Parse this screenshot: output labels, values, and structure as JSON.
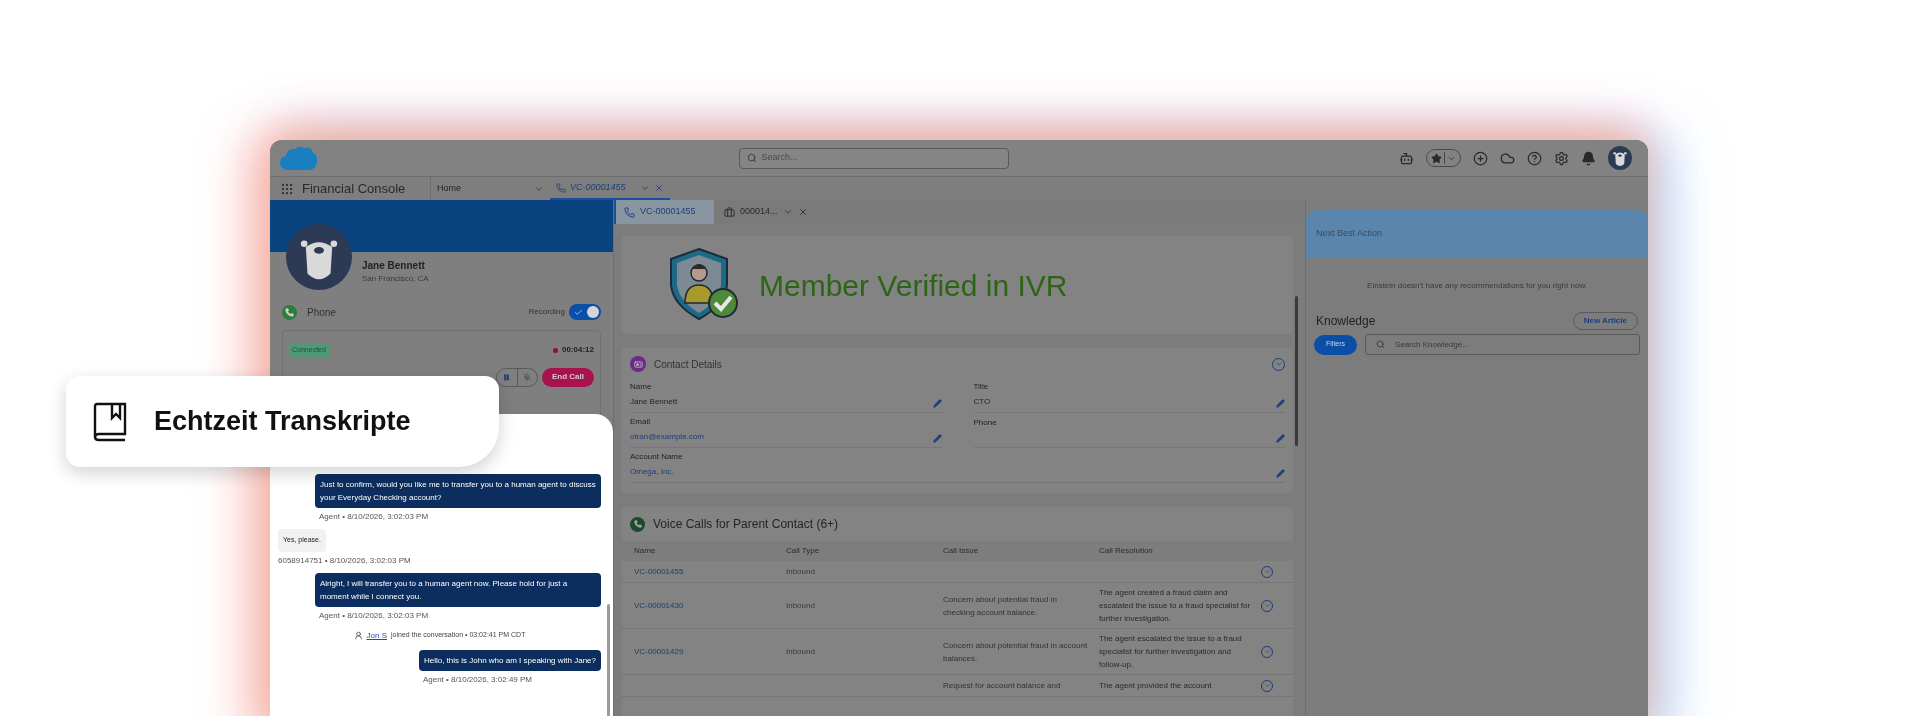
{
  "header": {
    "search_placeholder": "Search..."
  },
  "nav": {
    "app_name": "Financial Console",
    "home_tab": "Home",
    "tabs": [
      {
        "label": "VC-00001455",
        "selected": true
      }
    ]
  },
  "contact_card": {
    "name": "Jane Bennett",
    "location": "San Francisco, CA"
  },
  "phone": {
    "label": "Phone",
    "recording_label": "Recording",
    "recording_on": true,
    "status": "Connected",
    "timer": "00:04:12",
    "end_call": "End Call"
  },
  "subtabs": [
    {
      "label": "VC-00001455",
      "selected": true,
      "kind": "call"
    },
    {
      "label": "000014...",
      "selected": false,
      "kind": "case"
    }
  ],
  "banner": {
    "text": "Member Verified in IVR"
  },
  "contact_details": {
    "title": "Contact Details",
    "fields": [
      {
        "label": "Name",
        "value": "Jane Bennett",
        "link": false,
        "full_width": false
      },
      {
        "label": "Title",
        "value": "CTO",
        "link": false,
        "full_width": false
      },
      {
        "label": "Email",
        "value": "otran@example.com",
        "link": true,
        "full_width": false
      },
      {
        "label": "Phone",
        "full_width": false
      },
      {
        "label": "Account Name",
        "value": "Omega, Inc.",
        "link": true,
        "full_width": true
      }
    ]
  },
  "voice_calls": {
    "title": "Voice Calls for Parent Contact (6+)",
    "columns": [
      "Name",
      "Call Type",
      "Call Issue",
      "Call Resolution"
    ],
    "rows": [
      {
        "name": "VC-00001455",
        "call_type": "Inbound"
      },
      {
        "name": "VC-00001430",
        "call_type": "Inbound",
        "issue": "Concern about potential fraud in checking account balance.",
        "resolution": "The agent created a fraud claim and escalated the issue to a fraud specialist for further investigation."
      },
      {
        "name": "VC-00001429",
        "call_type": "Inbound",
        "issue": "Concern about potential fraud in account balances.",
        "resolution": "The agent escalated the issue to a fraud specialist for further investigation and follow-up."
      },
      {
        "issue": "Request for account balance and",
        "resolution": "The agent provided the account"
      }
    ]
  },
  "next_best_action": {
    "title": "Next Best Action",
    "message": "Einstein doesn't have any recommendations for you right now."
  },
  "knowledge": {
    "title": "Knowledge",
    "new_button": "New Article",
    "filters_button": "Filters",
    "search_placeholder": "Search Knowledge..."
  },
  "callout": {
    "label": "Echtzeit Transkripte"
  },
  "transcript": {
    "messages": [
      {
        "kind": "agent",
        "text": "Just to confirm, would you like me to transfer you to a human agent to discuss your Everyday Checking account?",
        "meta": "Agent • 8/10/2026, 3:02:03 PM"
      },
      {
        "kind": "customer",
        "text": "Yes, please.",
        "meta": "6058914751 • 8/10/2026, 3:02:03 PM"
      },
      {
        "kind": "agent",
        "text": "Alright, I will transfer you to a human agent now. Please hold for just a moment while I connect you.",
        "meta": "Agent • 8/10/2026, 3:02:03 PM"
      },
      {
        "kind": "system",
        "user": "Jon S",
        "text": "joined the conversation • 03:02:41 PM CDT"
      },
      {
        "kind": "agent",
        "text": "Hello, this is John who am I speaking with Jane?",
        "meta": "Agent • 8/10/2026, 3:02:49 PM"
      }
    ]
  }
}
